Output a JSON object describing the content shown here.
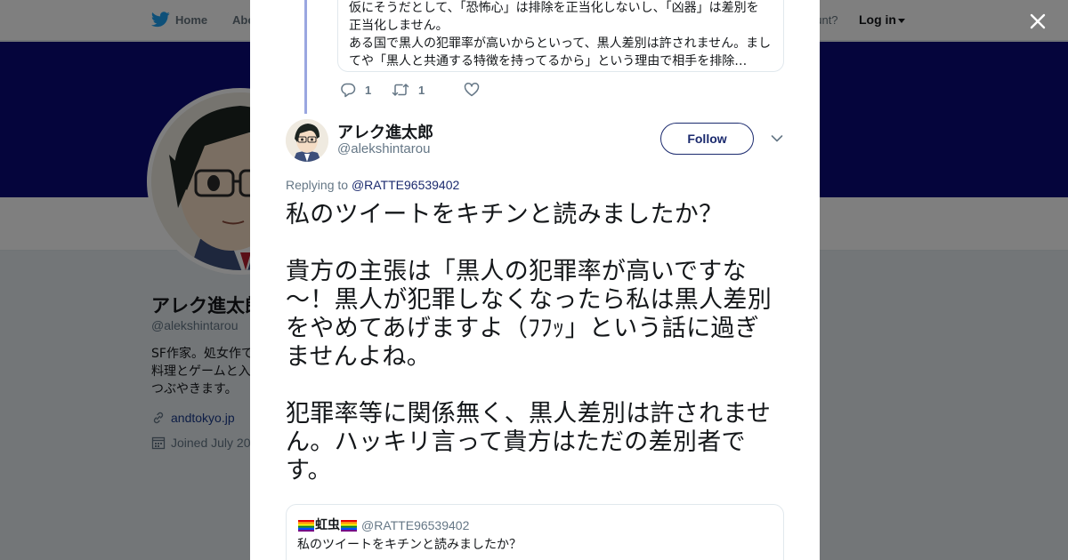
{
  "topnav": {
    "home": "Home",
    "about": "Abo",
    "account_prompt": "ccount?",
    "login": "Log in"
  },
  "profile": {
    "name": "アレク進太郎",
    "handle": "@alekshintarou",
    "bio": [
      "SF作家。処女作で",
      "料理とゲームと入",
      "つぶやきます。"
    ],
    "link": "andtokyo.jp",
    "joined": "Joined July 20"
  },
  "thread": {
    "quoted_lines": [
      "仮にそうだとして、「恐怖心」は排除を正当化しないし、「凶器」は差別を",
      "正当化しません。",
      "ある国で黒人の犯罪率が高いからといって、黒人差別は許されません。まし",
      "てや「黒人と共通する特徴を持ってるから」という理由で相手を排除…"
    ],
    "reply_count": "1",
    "retweet_count": "1"
  },
  "tweet": {
    "author_name": "アレク進太郎",
    "author_handle": "@alekshintarou",
    "follow_label": "Follow",
    "replying_prefix": "Replying to",
    "replying_to": "@RATTE96539402",
    "paragraphs": [
      [
        "私のツイートをキチンと読みましたか？"
      ],
      [
        "貴方の主張は「黒人の犯罪率が高いですな",
        "～！黒人が犯罪しなくなったら私は黒人差別",
        "をやめてあげますよ（ﾌﾌｯ」という話に過ぎ",
        "ませんよね。"
      ],
      [
        "犯罪率等に関係無く、黒人差別は許されませ",
        "ん。ハッキリ言って貴方はただの差別者で",
        "す。"
      ]
    ]
  },
  "quoted": {
    "name": "虹虫",
    "handle": "@RATTE96539402",
    "text": "私のツイートをキチンと読みましたか？"
  },
  "colors": {
    "banner": "#0a0a78",
    "link": "#1b2a6e",
    "thread_line": "#9aa6e0",
    "twitter_blue": "#1da1f2"
  },
  "icons": [
    "twitter-bird-icon",
    "close-icon",
    "reply-icon",
    "retweet-icon",
    "like-icon",
    "chevron-down-icon",
    "link-icon",
    "calendar-icon",
    "rainbow-flag-icon"
  ]
}
